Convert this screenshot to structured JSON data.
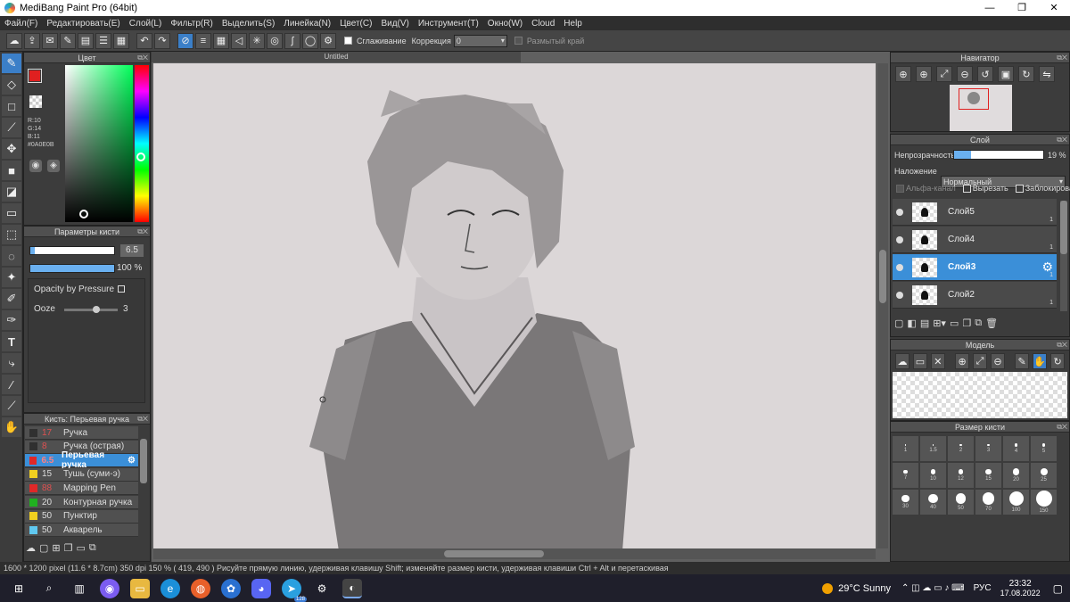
{
  "window": {
    "title": "MediBang Paint Pro (64bit)",
    "minimize": "—",
    "maximize": "❐",
    "close": "✕"
  },
  "menu": [
    "Файл(F)",
    "Редактировать(E)",
    "Слой(L)",
    "Фильтр(R)",
    "Выделить(S)",
    "Линейка(N)",
    "Цвет(C)",
    "Вид(V)",
    "Инструмент(T)",
    "Окно(W)",
    "Cloud",
    "Help"
  ],
  "toolbar": {
    "smoothing_label": "Сглаживание",
    "correction_label": "Коррекция",
    "correction_value": "0",
    "blur_edge_label": "Размытый край"
  },
  "color_panel": {
    "title": "Цвет",
    "r": "R:10",
    "g": "G:14",
    "b": "B:11",
    "hex": "#0A0E0B",
    "current_color": "#e02020"
  },
  "brush_params": {
    "title": "Параметры кисти",
    "size_value": "6.5",
    "opacity_value": "100 %",
    "size_fraction": 0.05,
    "opacity_fraction": 1.0,
    "opacity_by_pressure": "Opacity by Pressure",
    "ooze_label": "Ooze",
    "ooze_value": "3",
    "ooze_fraction": 0.6
  },
  "brush_list": {
    "title": "Кисть: Перьевая ручка",
    "items": [
      {
        "size": "17",
        "name": "Ручка",
        "color": "#303030"
      },
      {
        "size": "8",
        "name": "Ручка (острая)",
        "color": "#303030"
      },
      {
        "size": "6.5",
        "name": "Перьевая ручка",
        "color": "#e02828"
      },
      {
        "size": "15",
        "name": "Тушь (суми-э)",
        "color": "#f0d020"
      },
      {
        "size": "88",
        "name": "Mapping Pen",
        "color": "#e02828"
      },
      {
        "size": "20",
        "name": "Контурная ручка",
        "color": "#20b020"
      },
      {
        "size": "50",
        "name": "Пунктир",
        "color": "#f0d020"
      },
      {
        "size": "50",
        "name": "Акварель",
        "color": "#60c8f0"
      }
    ]
  },
  "document": {
    "tab": "Untitled"
  },
  "navigator": {
    "title": "Навигатор"
  },
  "layers": {
    "title": "Слой",
    "opacity_label": "Непрозрачность",
    "opacity_value": "19 %",
    "opacity_fraction": 0.19,
    "blend_label": "Наложение",
    "blend_value": "Нормальный",
    "alpha_label": "Альфа-канал",
    "clip_label": "Вырезать",
    "lock_label": "Заблокировать",
    "items": [
      {
        "name": "Слой5",
        "num": "1",
        "selected": false
      },
      {
        "name": "Слой4",
        "num": "1",
        "selected": false
      },
      {
        "name": "Слой3",
        "num": "1",
        "selected": true
      },
      {
        "name": "Слой2",
        "num": "1",
        "selected": false
      }
    ]
  },
  "model": {
    "title": "Модель"
  },
  "brush_size": {
    "title": "Размер кисти",
    "sizes": [
      "1",
      "1.5",
      "2",
      "3",
      "4",
      "5",
      "7",
      "10",
      "12",
      "15",
      "20",
      "25",
      "30",
      "40",
      "50",
      "70",
      "100",
      "150"
    ]
  },
  "status": {
    "text": "1600 * 1200 pixel   (11.6 * 8.7cm)   350 dpi   150 %   ( 419, 490 )   Рисуйте прямую линию, удерживая клавишу Shift; изменяйте размер кисти, удерживая клавиши Ctrl + Alt и перетаскивая"
  },
  "taskbar": {
    "weather": "29°C  Sunny",
    "lang": "РУС",
    "time": "23:32",
    "date": "17.08.2022",
    "badge": "128"
  }
}
